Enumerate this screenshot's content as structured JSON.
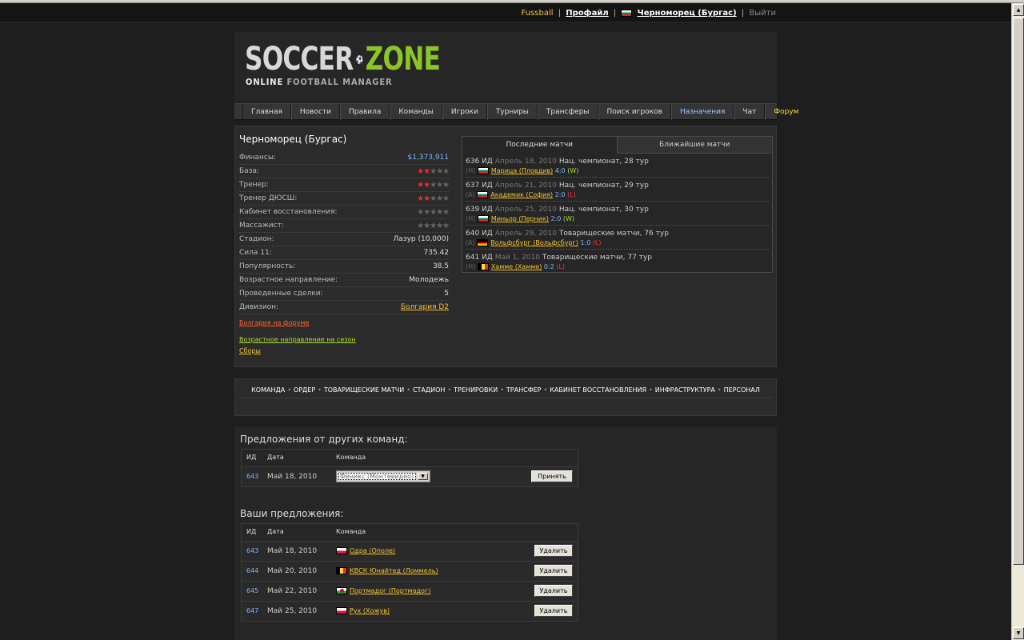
{
  "topbar": {
    "fussball": "Fussball",
    "profile": "Профайл",
    "team": "Черноморец (Бургас)",
    "logout": "Выйти",
    "team_flag": "flag-bulgaria"
  },
  "logo": {
    "word1": "SOCCER",
    "word2": "ZONE",
    "sub1": "ONLINE",
    "sub2": "FOOTBALL",
    "sub3": "MANAGER"
  },
  "nav": [
    "Главная",
    "Новости",
    "Правила",
    "Команды",
    "Игроки",
    "Турниры",
    "Трансферы",
    "Поиск игроков",
    "Назначения",
    "Чат",
    "Форум"
  ],
  "team": {
    "title": "Черноморец (Бургас)",
    "stats": [
      {
        "label": "Финансы:",
        "value": "$1,373,911"
      },
      {
        "label": "База:",
        "stars": 2
      },
      {
        "label": "Тренер:",
        "stars": 2
      },
      {
        "label": "Тренер ДЮСШ:",
        "stars": 2
      },
      {
        "label": "Кабинет восстановления:",
        "stars": 0
      },
      {
        "label": "Массажист:",
        "stars": 0
      },
      {
        "label": "Стадион:",
        "value": "Лазур (10,000)"
      },
      {
        "label": "Сила 11:",
        "value": "735.42"
      },
      {
        "label": "Популярность:",
        "value": "38.5"
      },
      {
        "label": "Возрастное направление:",
        "value": "Молодежь"
      },
      {
        "label": "Проведенные сделки:",
        "value": "5"
      },
      {
        "label": "Дивизион:",
        "value": "Болгария D2"
      }
    ],
    "links": {
      "forum": "Болгария на форуме",
      "age_direction": "Возрастное направление на сезон",
      "fees": "Сборы"
    }
  },
  "matches": {
    "tab_recent": "Последние матчи",
    "tab_upcoming": "Ближайшие матчи",
    "items": [
      {
        "id": "636 ИД",
        "date": "Апрель 18, 2010",
        "comp": "Нац. чемпионат, 28 тур",
        "venue": "(H)",
        "flag": "flag-bulgaria",
        "opponent": "Марица (Пловдив)",
        "score": "4:0",
        "result": "(W)"
      },
      {
        "id": "637 ИД",
        "date": "Апрель 21, 2010",
        "comp": "Нац. чемпионат, 29 тур",
        "venue": "(A)",
        "flag": "flag-bulgaria",
        "opponent": "Академик (София)",
        "score": "2:0",
        "result": "(L)"
      },
      {
        "id": "639 ИД",
        "date": "Апрель 25, 2010",
        "comp": "Нац. чемпионат, 30 тур",
        "venue": "(H)",
        "flag": "flag-bulgaria",
        "opponent": "Миньор (Перник)",
        "score": "2:0",
        "result": "(W)"
      },
      {
        "id": "640 ИД",
        "date": "Апрель 29, 2010",
        "comp": "Товарищеские матчи, 76 тур",
        "venue": "(A)",
        "flag": "flag-germany",
        "opponent": "Вольфсбург (Вольфсбург)",
        "score": "1:0",
        "result": "(L)"
      },
      {
        "id": "641 ИД",
        "date": "Май 1, 2010",
        "comp": "Товарищеские матчи, 77 тур",
        "venue": "(H)",
        "flag": "flag-belgium",
        "opponent": "Хамме (Хамме)",
        "score": "0:2",
        "result": "(L)"
      }
    ]
  },
  "teamnav": [
    "КОМАНДА",
    "ОРДЕР",
    "ТОВАРИЩЕСКИЕ МАТЧИ",
    "СТАДИОН",
    "ТРЕНИРОВКИ",
    "ТРАНСФЕР",
    "КАБИНЕТ ВОССТАНОВЛЕНИЯ",
    "ИНФРАСТРУКТУРА",
    "ПЕРСОНАЛ"
  ],
  "incoming": {
    "title": "Предложения от других команд:",
    "headers": {
      "id": "ИД",
      "date": "Дата",
      "team": "Команда"
    },
    "rows": [
      {
        "id": "643",
        "date": "Май 18, 2010",
        "select_value": "Феникс (Монтевидео)",
        "button": "Принять"
      }
    ]
  },
  "outgoing": {
    "title": "Ваши предложения:",
    "headers": {
      "id": "ИД",
      "date": "Дата",
      "team": "Команда"
    },
    "rows": [
      {
        "id": "643",
        "date": "Май 18, 2010",
        "flag": "flag-poland",
        "team": "Одра (Ополе)",
        "button": "Удалить"
      },
      {
        "id": "644",
        "date": "Май 20, 2010",
        "flag": "flag-belgium",
        "team": "КВСК Юнайтед (Ломмель)",
        "button": "Удалить"
      },
      {
        "id": "645",
        "date": "Май 22, 2010",
        "flag": "flag-wales",
        "team": "Портмадог (Портмадог)",
        "button": "Удалить"
      },
      {
        "id": "647",
        "date": "Май 25, 2010",
        "flag": "flag-poland",
        "team": "Рух (Хожув)",
        "button": "Удалить"
      }
    ]
  },
  "colors": {
    "accent_gold": "#f4c430",
    "accent_blue": "#7fb6ff",
    "win_green": "#a9e030",
    "loss_red": "#ff3333",
    "logo_green": "#8bc528"
  }
}
